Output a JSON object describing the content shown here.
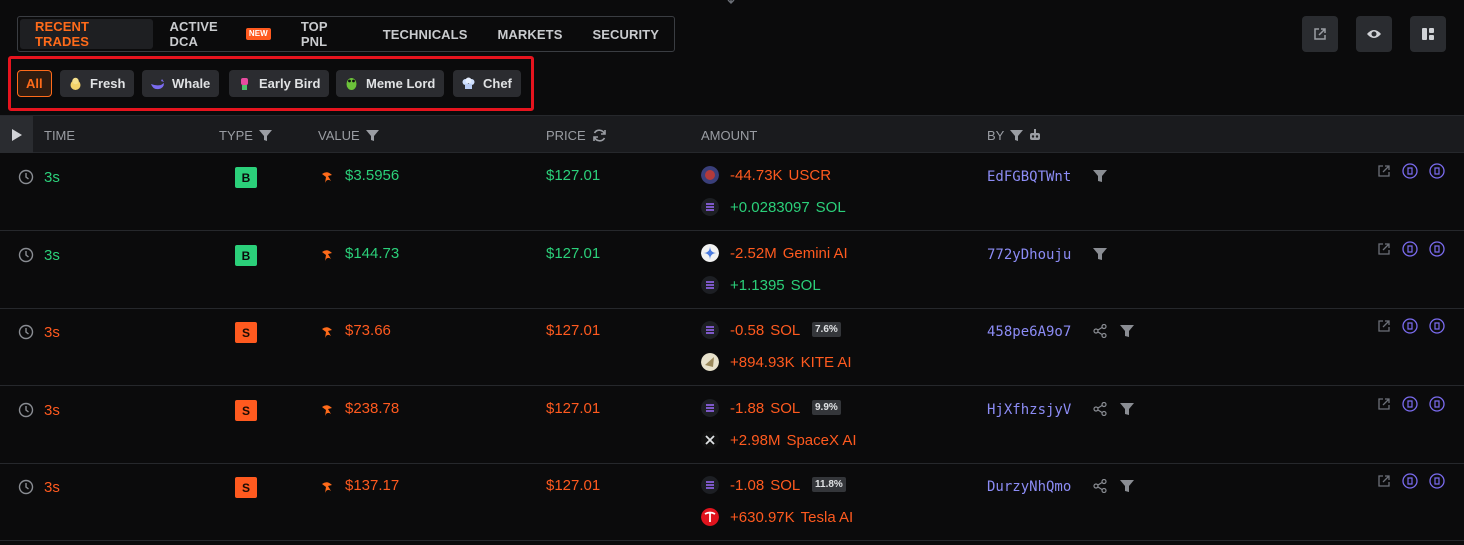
{
  "tabs": [
    {
      "label": "RECENT TRADES",
      "active": true
    },
    {
      "label": "ACTIVE DCA",
      "badge": "NEW"
    },
    {
      "label": "TOP PNL"
    },
    {
      "label": "TECHNICALS"
    },
    {
      "label": "MARKETS"
    },
    {
      "label": "SECURITY"
    }
  ],
  "top_buttons": [
    "external-link-icon",
    "eye-icon",
    "layout-icon"
  ],
  "filters": [
    {
      "label": "All",
      "active": true
    },
    {
      "label": "Fresh",
      "icon": "chick-icon"
    },
    {
      "label": "Whale",
      "icon": "whale-icon"
    },
    {
      "label": "Early Bird",
      "icon": "bird-icon"
    },
    {
      "label": "Meme Lord",
      "icon": "frog-icon"
    },
    {
      "label": "Chef",
      "icon": "chef-hat-icon"
    }
  ],
  "columns": {
    "time": "TIME",
    "type": "TYPE",
    "value": "VALUE",
    "price": "PRICE",
    "amount": "AMOUNT",
    "by": "BY"
  },
  "rows": [
    {
      "time": "3s",
      "type": "B",
      "value": "$3.5956",
      "price": "$127.01",
      "amt1": "-44.73K",
      "sym1": "USCR",
      "amt2": "+0.0283097",
      "sym2": "SOL",
      "pct": "",
      "by": "EdFGBQTWnt",
      "side": "buy"
    },
    {
      "time": "3s",
      "type": "B",
      "value": "$144.73",
      "price": "$127.01",
      "amt1": "-2.52M",
      "sym1": "Gemini AI",
      "amt2": "+1.1395",
      "sym2": "SOL",
      "pct": "",
      "by": "772yDhouju",
      "side": "buy"
    },
    {
      "time": "3s",
      "type": "S",
      "value": "$73.66",
      "price": "$127.01",
      "amt1": "-0.58",
      "sym1": "SOL",
      "amt2": "+894.93K",
      "sym2": "KITE AI",
      "pct": "7.6%",
      "by": "458pe6A9o7",
      "side": "sell"
    },
    {
      "time": "3s",
      "type": "S",
      "value": "$238.78",
      "price": "$127.01",
      "amt1": "-1.88",
      "sym1": "SOL",
      "amt2": "+2.98M",
      "sym2": "SpaceX AI",
      "pct": "9.9%",
      "by": "HjXfhzsjyV",
      "side": "sell"
    },
    {
      "time": "3s",
      "type": "S",
      "value": "$137.17",
      "price": "$127.01",
      "amt1": "-1.08",
      "sym1": "SOL",
      "amt2": "+630.97K",
      "sym2": "Tesla AI",
      "pct": "11.8%",
      "by": "DurzyNhQmo",
      "side": "sell"
    }
  ],
  "colors": {
    "accent": "#ff6b1a",
    "buy": "#2bd07a",
    "sell": "#ff5a1f",
    "address": "#8c8cf5"
  }
}
